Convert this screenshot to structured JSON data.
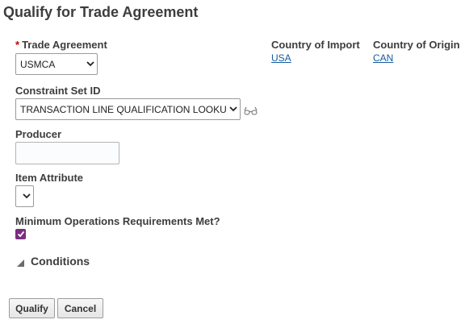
{
  "page": {
    "title": "Qualify for Trade Agreement"
  },
  "form": {
    "trade_agreement": {
      "required_marker": "*",
      "label": "Trade Agreement",
      "value": "USMCA"
    },
    "country_of_import": {
      "label": "Country of Import",
      "value": "USA"
    },
    "country_of_origin": {
      "label": "Country of Origin",
      "value": "CAN"
    },
    "constraint_set": {
      "label": "Constraint Set ID",
      "value": "TRANSACTION LINE QUALIFICATION LOOKUP"
    },
    "producer": {
      "label": "Producer",
      "value": ""
    },
    "item_attribute": {
      "label": "Item Attribute",
      "value": ""
    },
    "min_operations": {
      "label": "Minimum Operations Requirements Met?",
      "checked": true
    },
    "conditions": {
      "label": "Conditions"
    }
  },
  "buttons": {
    "qualify": "Qualify",
    "cancel": "Cancel"
  },
  "icons": {
    "trade_agreement_select": "chevron-down-icon",
    "constraint_search": "glasses-icon",
    "conditions_toggle": "disclosure-triangle-icon",
    "checkbox_mark": "check-icon"
  },
  "colors": {
    "link": "#145c9e",
    "checkbox": "#7b2d7f",
    "required": "#c00000"
  }
}
